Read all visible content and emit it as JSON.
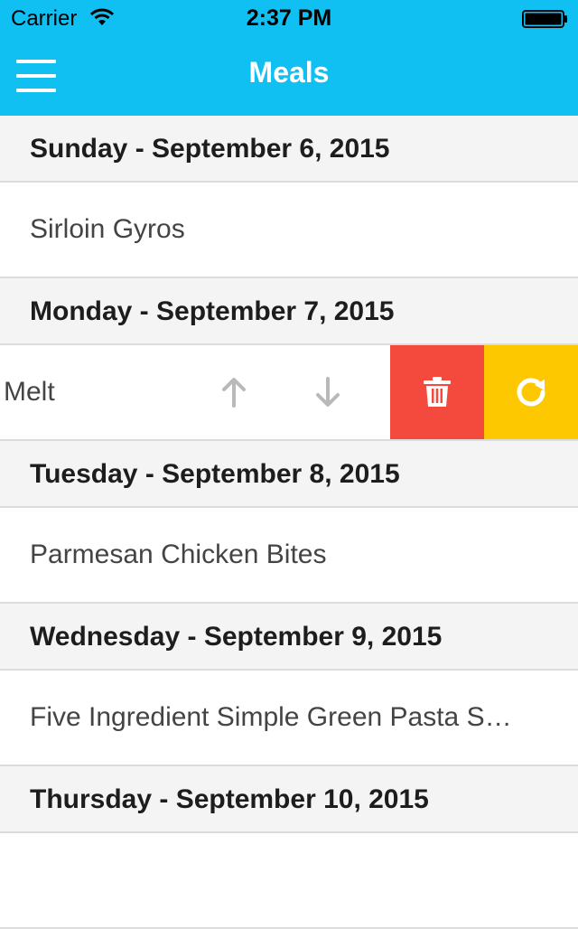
{
  "status_bar": {
    "carrier": "Carrier",
    "time": "2:37 PM"
  },
  "nav": {
    "title": "Meals"
  },
  "days": [
    {
      "heading": "Sunday - September 6, 2015",
      "meal": "Sirloin Gyros"
    },
    {
      "heading": "Monday - September 7, 2015",
      "meal": "Melt",
      "actions": [
        "move-up",
        "move-down",
        "delete",
        "replace"
      ]
    },
    {
      "heading": "Tuesday - September 8, 2015",
      "meal": "Parmesan Chicken Bites"
    },
    {
      "heading": "Wednesday - September 9, 2015",
      "meal": "Five Ingredient Simple Green Pasta S…"
    },
    {
      "heading": "Thursday - September 10, 2015"
    }
  ],
  "colors": {
    "nav_background": "#11c0f3",
    "delete_action": "#f44a3e",
    "replace_action": "#fec800",
    "arrow_icon": "#b9b9b9"
  }
}
